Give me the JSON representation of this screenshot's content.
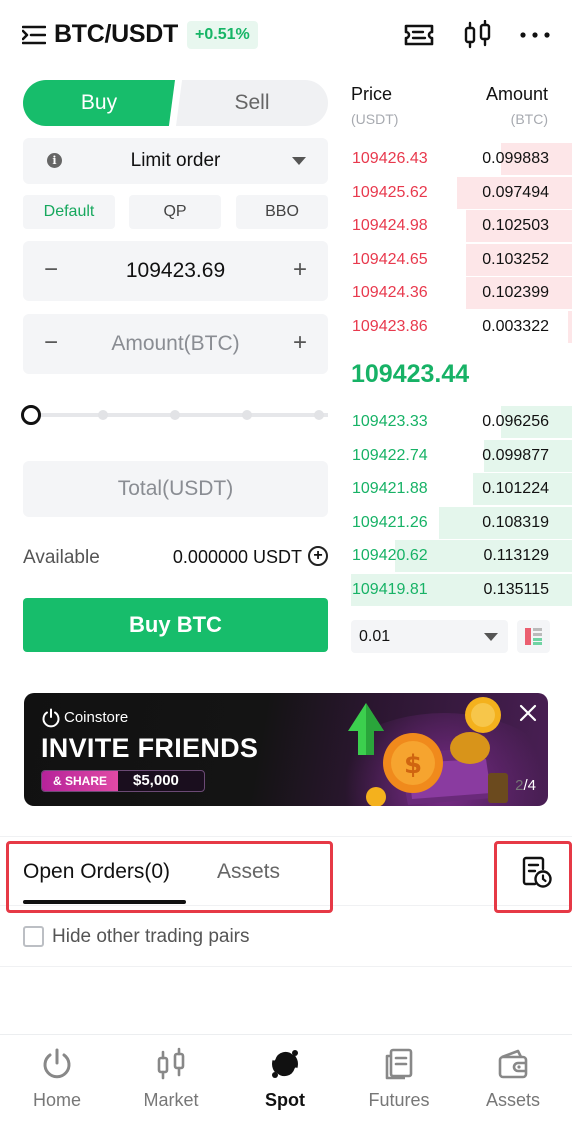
{
  "header": {
    "pair": "BTC/USDT",
    "change": "+0.51%"
  },
  "order_form": {
    "buy_tab": "Buy",
    "sell_tab": "Sell",
    "order_type": "Limit order",
    "price_options": [
      "Default",
      "QP",
      "BBO"
    ],
    "price_value": "109423.69",
    "amount_placeholder": "Amount(BTC)",
    "slider_level": 0,
    "total_placeholder": "Total(USDT)",
    "available_label": "Available",
    "available_value": "0.000000 USDT",
    "submit_label": "Buy BTC"
  },
  "order_book": {
    "price_header": "Price",
    "price_unit": "(USDT)",
    "amount_header": "Amount",
    "amount_unit": "(BTC)",
    "asks": [
      {
        "price": "109426.43",
        "amount": "0.099883",
        "depth": 0.32
      },
      {
        "price": "109425.62",
        "amount": "0.097494",
        "depth": 0.52
      },
      {
        "price": "109424.98",
        "amount": "0.102503",
        "depth": 0.48
      },
      {
        "price": "109424.65",
        "amount": "0.103252",
        "depth": 0.48
      },
      {
        "price": "109424.36",
        "amount": "0.102399",
        "depth": 0.48
      },
      {
        "price": "109423.86",
        "amount": "0.003322",
        "depth": 0.02
      }
    ],
    "last_price": "109423.44",
    "bids": [
      {
        "price": "109423.33",
        "amount": "0.096256",
        "depth": 0.32
      },
      {
        "price": "109422.74",
        "amount": "0.099877",
        "depth": 0.4
      },
      {
        "price": "109421.88",
        "amount": "0.101224",
        "depth": 0.45
      },
      {
        "price": "109421.26",
        "amount": "0.108319",
        "depth": 0.6
      },
      {
        "price": "109420.62",
        "amount": "0.113129",
        "depth": 0.8
      },
      {
        "price": "109419.81",
        "amount": "0.135115",
        "depth": 1.0
      }
    ],
    "precision": "0.01"
  },
  "banner": {
    "brand": "Coinstore",
    "title": "INVITE FRIENDS",
    "share_tag": "& SHARE",
    "share_amount": "$5,000",
    "page_current": "2",
    "page_total": "/4"
  },
  "orders_tabs": {
    "open_orders": "Open Orders(0)",
    "assets": "Assets",
    "hide_pairs": "Hide other trading pairs"
  },
  "bottom_nav": [
    {
      "label": "Home",
      "icon": "power-icon"
    },
    {
      "label": "Market",
      "icon": "candlestick-icon"
    },
    {
      "label": "Spot",
      "icon": "spot-exchange-icon"
    },
    {
      "label": "Futures",
      "icon": "futures-document-icon"
    },
    {
      "label": "Assets",
      "icon": "wallet-icon"
    }
  ],
  "colors": {
    "green": "#17bd6b",
    "red": "#e8394d",
    "highlight": "#e63946"
  }
}
